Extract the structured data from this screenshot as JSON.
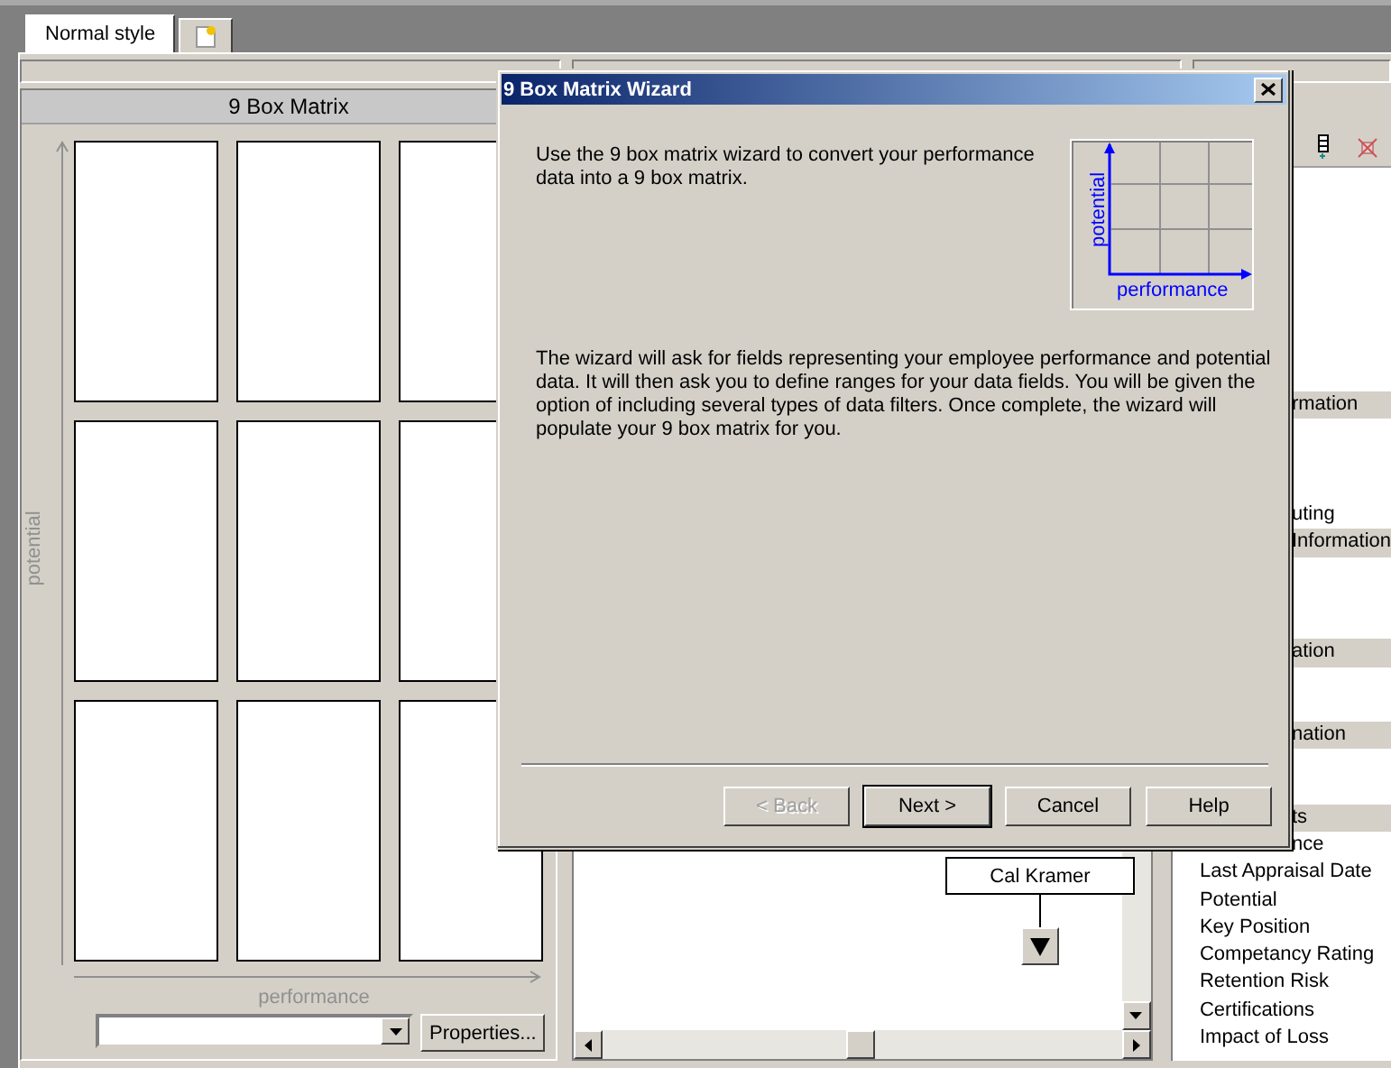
{
  "tabs": [
    {
      "kind": "text",
      "label": "Normal style",
      "selected": true
    },
    {
      "kind": "icon",
      "selected": false
    }
  ],
  "matrix_panel": {
    "title": "9 Box Matrix",
    "y_axis": "potential",
    "x_axis": "performance",
    "properties_button": "Properties..."
  },
  "chart": {
    "nodes": [
      {
        "name": "Cal Kramer"
      }
    ]
  },
  "fields_panel": {
    "rows": [
      {
        "kind": "section",
        "text": "rmation",
        "clipped": true
      },
      {
        "kind": "field",
        "text": "uting",
        "clipped": true
      },
      {
        "kind": "section",
        "text": "Information",
        "clipped": true
      },
      {
        "kind": "section",
        "text": "ation",
        "clipped": true
      },
      {
        "kind": "section",
        "text": "nation",
        "clipped": true
      },
      {
        "kind": "section",
        "text": "ts",
        "clipped": true
      },
      {
        "kind": "field",
        "text": "nce",
        "clipped": true
      },
      {
        "kind": "field",
        "text": "Last Appraisal Date",
        "clipped": false
      },
      {
        "kind": "field",
        "text": "Potential",
        "clipped": false
      },
      {
        "kind": "field",
        "text": "Key Position",
        "clipped": false
      },
      {
        "kind": "field",
        "text": "Competancy Rating",
        "clipped": false
      },
      {
        "kind": "field",
        "text": "Retention Risk",
        "clipped": false
      },
      {
        "kind": "field",
        "text": "Certifications",
        "clipped": false
      },
      {
        "kind": "field",
        "text": "Impact of Loss",
        "clipped": false
      }
    ]
  },
  "dialog": {
    "title": "9 Box Matrix Wizard",
    "intro": "Use the 9 box matrix wizard to convert your performance data into a 9 box matrix.",
    "diagram": {
      "y_label": "potential",
      "x_label": "performance"
    },
    "details": "The wizard will ask for fields representing your employee performance and potential data. It will then ask you to define ranges for your data fields. You will be given the option of including several types of data filters. Once complete, the wizard will populate your 9 box matrix for you.",
    "buttons": [
      {
        "label": "< Back",
        "disabled": true,
        "default": false
      },
      {
        "label": "Next >",
        "disabled": false,
        "default": true
      },
      {
        "label": "Cancel",
        "disabled": false,
        "default": false
      },
      {
        "label": "Help",
        "disabled": false,
        "default": false
      }
    ]
  }
}
